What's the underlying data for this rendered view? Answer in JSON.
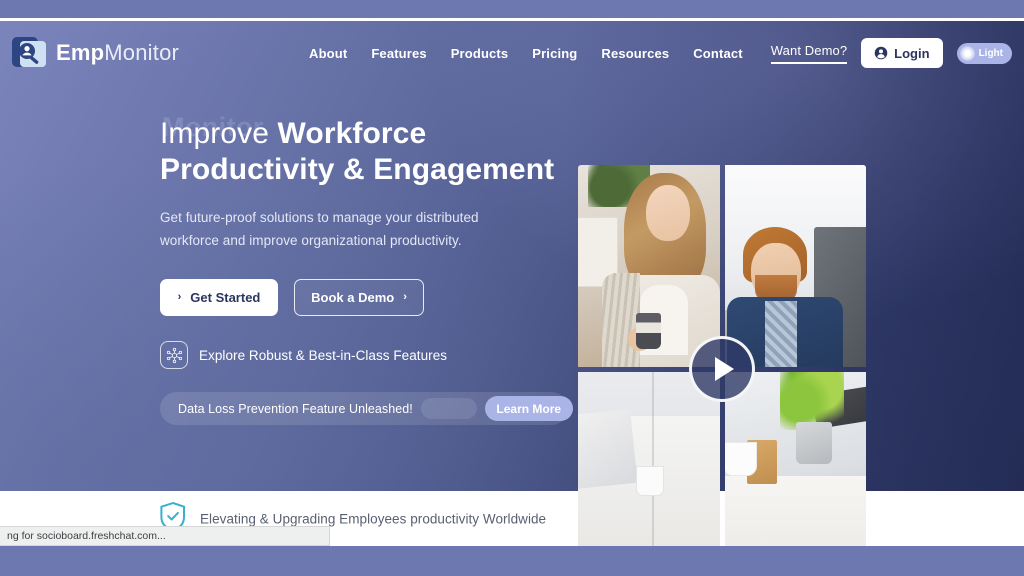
{
  "browser": {
    "status_text": "ng for socioboard.freshchat.com..."
  },
  "navbar": {
    "brand_bold": "Emp",
    "brand_thin": "Monitor",
    "brand_icon": "person-magnifier-logo-icon",
    "links": [
      {
        "label": "About"
      },
      {
        "label": "Features"
      },
      {
        "label": "Products"
      },
      {
        "label": "Pricing"
      },
      {
        "label": "Resources"
      },
      {
        "label": "Contact"
      }
    ],
    "want_demo_label": "Want Demo?",
    "login_label": "Login",
    "login_icon": "user-account-icon",
    "theme_toggle_label": "Light",
    "theme_toggle_icon": "sun-icon"
  },
  "hero": {
    "ghost_word": "Monitor",
    "title_line1_plain": "Improve ",
    "title_line1_highlight": "Workforce",
    "title_line2": "Productivity & Engagement",
    "subtitle": "Get future-proof solutions to manage your distributed workforce and improve organizational productivity.",
    "primary_cta": "Get Started",
    "primary_cta_chevron": "›",
    "secondary_cta": "Book a Demo",
    "secondary_cta_chevron": "›",
    "explore_label": "Explore Robust & Best-in-Class Features",
    "explore_icon": "network-nodes-icon",
    "announcement_text": "Data Loss Prevention Feature Unleashed!",
    "announcement_cta": "Learn More",
    "play_button_icon": "play-icon"
  },
  "trust": {
    "icon": "shield-check-icon",
    "label": "Elevating & Upgrading Employees productivity Worldwide"
  },
  "colors": {
    "hero_gradient_start": "#7b85bb",
    "hero_gradient_end": "#2e3864",
    "accent_periwinkle": "#aab4e6",
    "browser_band": "#6d78b0",
    "shield_teal": "#3ab0cf",
    "white": "#ffffff"
  }
}
